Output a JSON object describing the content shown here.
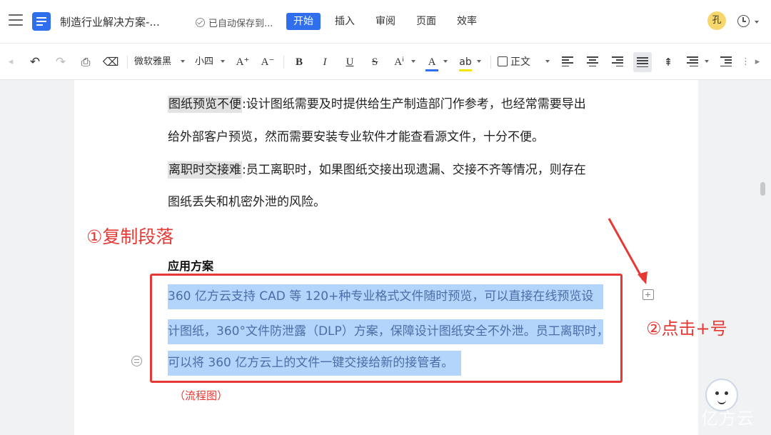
{
  "header": {
    "doc_title": "制造行业解决方案-...",
    "save_status": "已自动保存到...",
    "tabs": [
      "开始",
      "插入",
      "审阅",
      "页面",
      "效率"
    ],
    "active_tab": "开始",
    "user_avatar": "孔"
  },
  "toolbar": {
    "font_family": "微软雅黑",
    "font_size": "小四",
    "grow_font": "A⁺",
    "shrink_font": "A⁻",
    "bold": "B",
    "italic": "I",
    "underline": "U",
    "strike": "S",
    "style_label": "正文",
    "font_color_accent": "#2f6fed",
    "highlight_color": "#f2e600"
  },
  "document": {
    "p1_label": "图纸预览不便",
    "p1_rest": ":设计图纸需要及时提供给生产制造部门作参考，也经常需要导出",
    "p1_line2": "给外部客户预览，然而需要安装专业软件才能查看源文件，十分不便。",
    "p2_label": "离职时交接难",
    "p2_rest": ":员工离职时，如果图纸交接出现遗漏、交接不齐等情况，则存在",
    "p2_line2": "图纸丢失和机密外泄的风险。",
    "heading": "应用方案",
    "selected_lines": [
      "360 亿方云支持 CAD 等 120+种专业格式文件随时预览，可以直接在线预览设",
      "计图纸，360°文件防泄露（DLP）方案，保障设计图纸安全不外泄。员工离职时，",
      "可以将 360 亿方云上的文件一键交接给新的接管者。"
    ]
  },
  "annotations": {
    "copy_paragraph": "①复制段落",
    "click_plus": "②点击+号",
    "flowchart": "（流程图）",
    "accent_color": "#e53935"
  },
  "watermark": "亿方云"
}
